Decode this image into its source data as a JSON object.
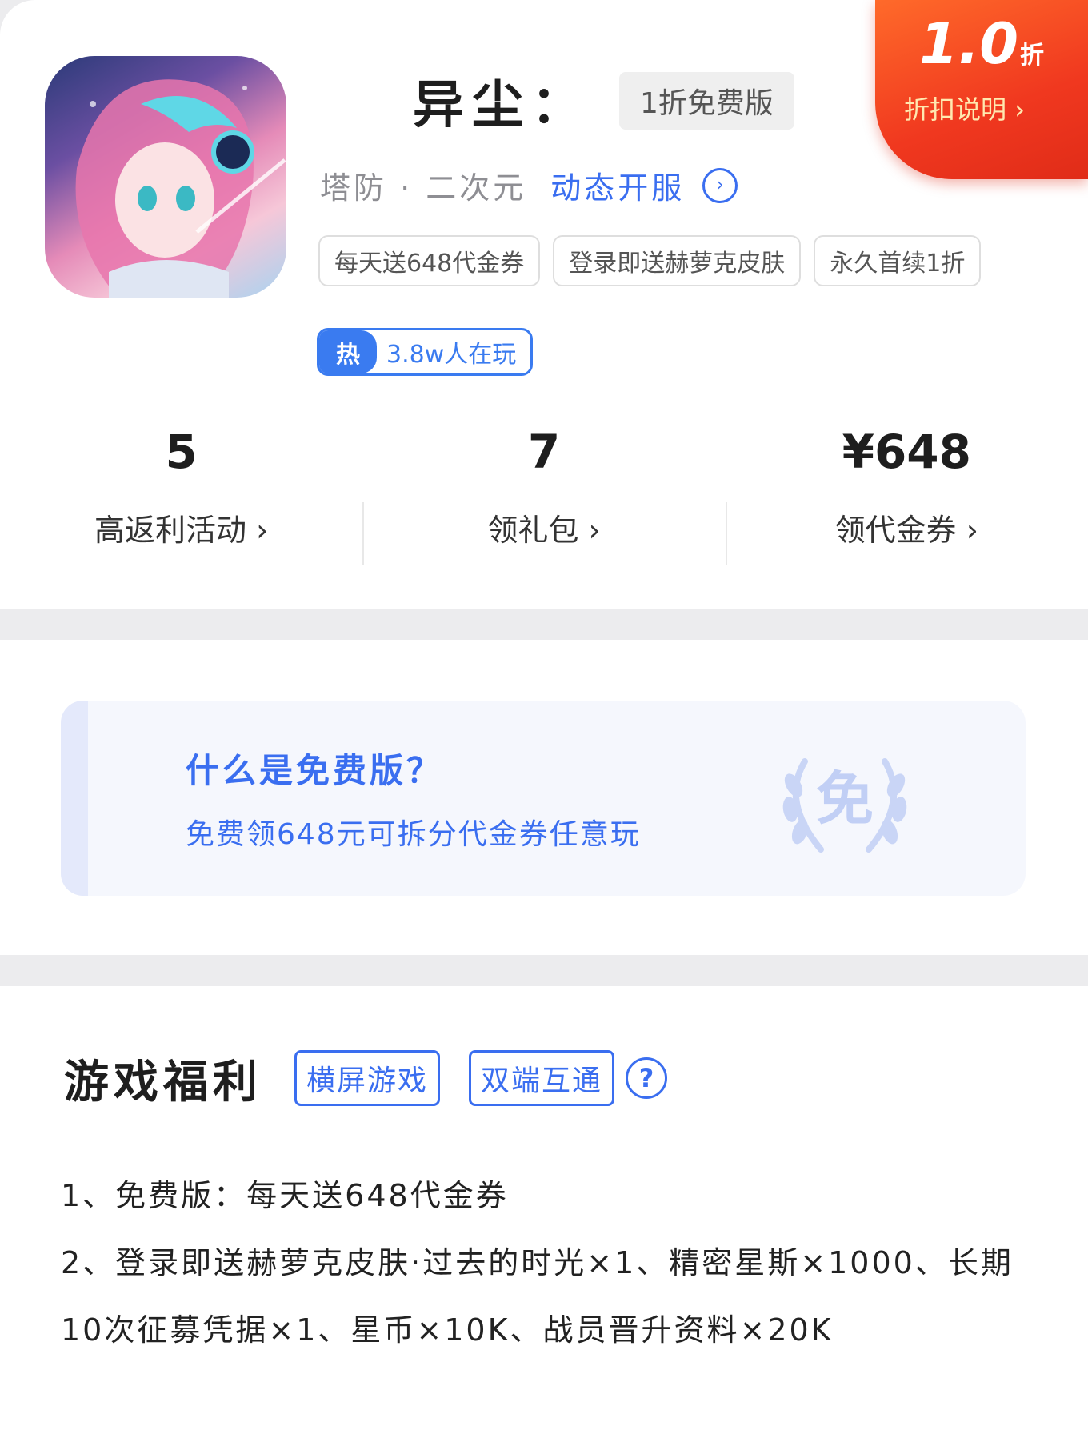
{
  "app": {
    "title": "异尘：",
    "version_chip": "1折免费版",
    "genre": "塔防 · 二次元",
    "server_label": "动态开服",
    "tags": [
      "每天送648代金券",
      "登录即送赫萝克皮肤",
      "永久首续1折"
    ],
    "hot_label": "热",
    "hot_text": "3.8w人在玩"
  },
  "discount": {
    "value": "1.0",
    "unit": "折",
    "link_label": "折扣说明",
    "color": "#f0381f"
  },
  "stats": [
    {
      "value": "5",
      "label": "高返利活动"
    },
    {
      "value": "7",
      "label": "领礼包"
    },
    {
      "value": "¥648",
      "label": "领代金券"
    }
  ],
  "free_banner": {
    "title": "什么是免费版？",
    "desc": "免费领648元可拆分代金券任意玩",
    "emblem_char": "免"
  },
  "welfare": {
    "title": "游戏福利",
    "badges": [
      "横屏游戏",
      "双端互通"
    ],
    "help_icon": "?",
    "items": [
      "1、免费版：每天送648代金券",
      "2、登录即送赫萝克皮肤·过去的时光×1、精密星斯×1000、长期10次征募凭据×1、星币×10K、战员晋升资料×20K"
    ]
  },
  "colors": {
    "accent": "#3a6ef0",
    "brand_red": "#f0381f"
  }
}
